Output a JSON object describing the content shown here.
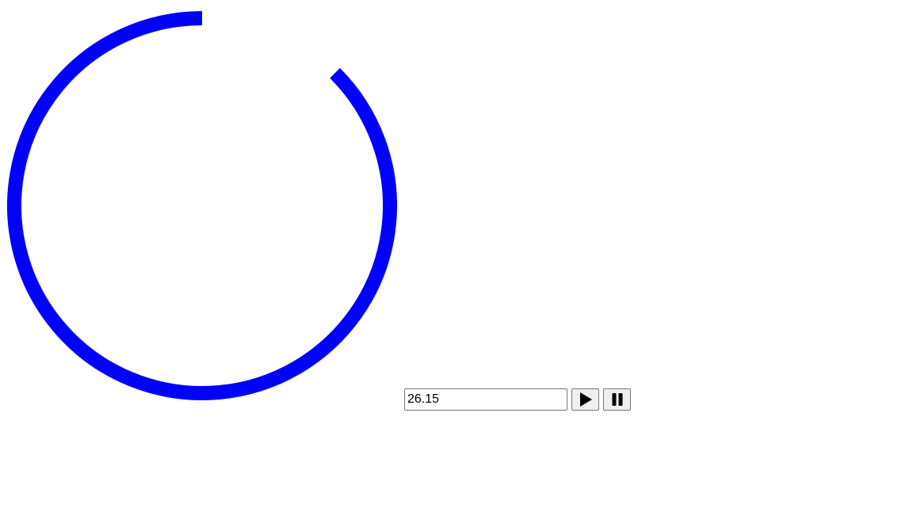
{
  "timer": {
    "input_value": "26.15",
    "remaining_fraction": 0.875,
    "ring_color": "#0000ff"
  },
  "controls": {
    "play_icon": "play-icon",
    "pause_icon": "pause-icon"
  }
}
